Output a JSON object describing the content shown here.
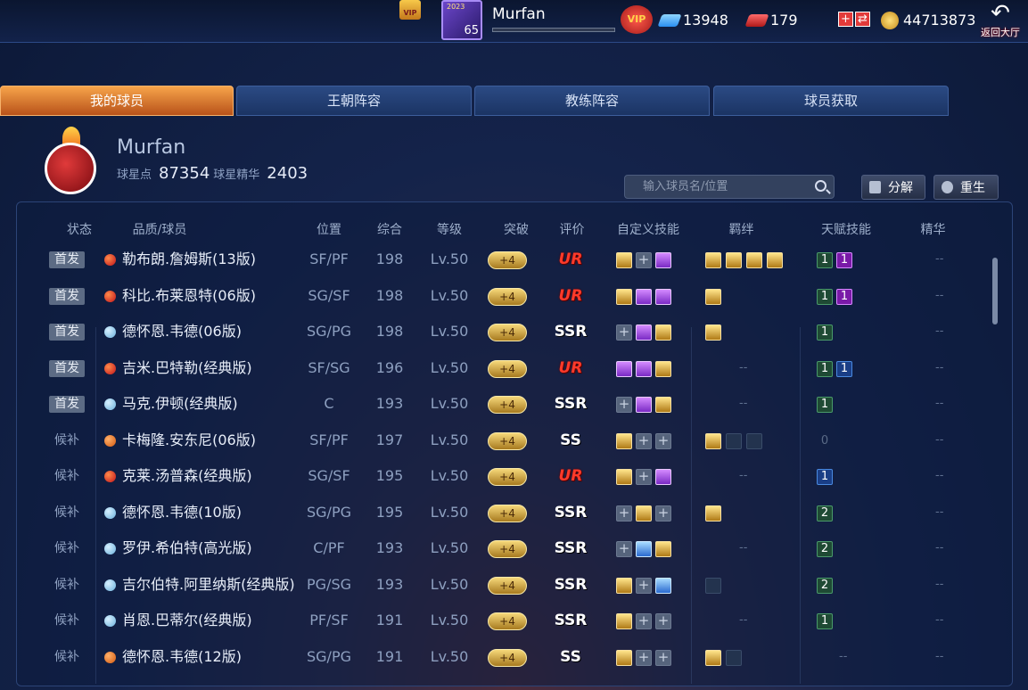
{
  "topbar": {
    "vip_crown": "VIP",
    "avatar_year": "2023",
    "level": "65",
    "username": "Murfan",
    "vip_badge": "VIP",
    "diamonds": "13948",
    "tickets": "179",
    "gold": "44713873",
    "back_label": "返回大厅",
    "icons": [
      "crown-icon",
      "diamond-icon",
      "ticket-icon",
      "coin-icon",
      "back-arrow-icon"
    ]
  },
  "tabs": [
    {
      "label": "我的球员",
      "active": true
    },
    {
      "label": "王朝阵容",
      "active": false
    },
    {
      "label": "教练阵容",
      "active": false
    },
    {
      "label": "球员获取",
      "active": false
    }
  ],
  "team": {
    "name": "Murfan",
    "star_points_label": "球星点",
    "star_points": "87354",
    "essence_label": "球星精华",
    "essence": "2403"
  },
  "toolbar": {
    "search_placeholder": "输入球员名/位置",
    "decompose_label": "分解",
    "rebirth_label": "重生"
  },
  "columns": [
    "状态",
    "品质/球员",
    "位置",
    "综合",
    "等级",
    "突破",
    "评价",
    "自定义技能",
    "羁绊",
    "天赋技能",
    "精华"
  ],
  "colors": {
    "accent_tab": "#e8842a",
    "grade_ur": "#ff3a2a",
    "panel": "#0c1c3e"
  },
  "players": [
    {
      "status": "首发",
      "starter": true,
      "quality": "red",
      "name": "勒布朗.詹姆斯(13版)",
      "position": "SF/PF",
      "overall": "198",
      "level": "Lv.50",
      "break": "+4",
      "grade": "UR",
      "skills": [
        "gold",
        "empty",
        "purple"
      ],
      "bonds": [
        "gold",
        "gold",
        "gold",
        "gold"
      ],
      "bond_text": "",
      "talents": [
        {
          "v": "1",
          "c": "green"
        },
        {
          "v": "1",
          "c": "purple"
        }
      ],
      "essence": "--"
    },
    {
      "status": "首发",
      "starter": true,
      "quality": "red",
      "name": "科比.布莱恩特(06版)",
      "position": "SG/SF",
      "overall": "198",
      "level": "Lv.50",
      "break": "+4",
      "grade": "UR",
      "skills": [
        "gold",
        "purple",
        "purple"
      ],
      "bonds": [
        "gold"
      ],
      "bond_text": "",
      "talents": [
        {
          "v": "1",
          "c": "green"
        },
        {
          "v": "1",
          "c": "purple"
        }
      ],
      "essence": "--"
    },
    {
      "status": "首发",
      "starter": true,
      "quality": "blue",
      "name": "德怀恩.韦德(06版)",
      "position": "SG/PG",
      "overall": "198",
      "level": "Lv.50",
      "break": "+4",
      "grade": "SSR",
      "skills": [
        "empty",
        "purple",
        "gold"
      ],
      "bonds": [
        "gold"
      ],
      "bond_text": "",
      "talents": [
        {
          "v": "1",
          "c": "green"
        }
      ],
      "essence": "--"
    },
    {
      "status": "首发",
      "starter": true,
      "quality": "red",
      "name": "吉米.巴特勒(经典版)",
      "position": "SF/SG",
      "overall": "196",
      "level": "Lv.50",
      "break": "+4",
      "grade": "UR",
      "skills": [
        "purple",
        "purple",
        "gold"
      ],
      "bonds": [],
      "bond_text": "--",
      "talents": [
        {
          "v": "1",
          "c": "green"
        },
        {
          "v": "1",
          "c": "blue"
        }
      ],
      "essence": "--"
    },
    {
      "status": "首发",
      "starter": true,
      "quality": "blue",
      "name": "马克.伊顿(经典版)",
      "position": "C",
      "overall": "193",
      "level": "Lv.50",
      "break": "+4",
      "grade": "SSR",
      "skills": [
        "empty",
        "purple",
        "gold"
      ],
      "bonds": [],
      "bond_text": "--",
      "talents": [
        {
          "v": "1",
          "c": "green"
        }
      ],
      "essence": "--"
    },
    {
      "status": "候补",
      "starter": false,
      "quality": "orange",
      "name": "卡梅隆.安东尼(06版)",
      "position": "SF/PF",
      "overall": "197",
      "level": "Lv.50",
      "break": "+4",
      "grade": "SS",
      "skills": [
        "gold",
        "empty",
        "empty"
      ],
      "bonds": [
        "gold",
        "dim",
        "dim"
      ],
      "bond_text": "",
      "talents": [
        {
          "v": "0",
          "c": "gray"
        }
      ],
      "essence": "--"
    },
    {
      "status": "候补",
      "starter": false,
      "quality": "red",
      "name": "克莱.汤普森(经典版)",
      "position": "SG/SF",
      "overall": "195",
      "level": "Lv.50",
      "break": "+4",
      "grade": "UR",
      "skills": [
        "gold",
        "empty",
        "purple"
      ],
      "bonds": [],
      "bond_text": "--",
      "talents": [
        {
          "v": "1",
          "c": "blue"
        }
      ],
      "essence": "--"
    },
    {
      "status": "候补",
      "starter": false,
      "quality": "blue",
      "name": "德怀恩.韦德(10版)",
      "position": "SG/PG",
      "overall": "195",
      "level": "Lv.50",
      "break": "+4",
      "grade": "SSR",
      "skills": [
        "empty",
        "gold",
        "empty"
      ],
      "bonds": [
        "gold"
      ],
      "bond_text": "",
      "talents": [
        {
          "v": "2",
          "c": "green"
        }
      ],
      "essence": "--"
    },
    {
      "status": "候补",
      "starter": false,
      "quality": "blue",
      "name": "罗伊.希伯特(高光版)",
      "position": "C/PF",
      "overall": "193",
      "level": "Lv.50",
      "break": "+4",
      "grade": "SSR",
      "skills": [
        "empty",
        "blue",
        "gold"
      ],
      "bonds": [],
      "bond_text": "--",
      "talents": [
        {
          "v": "2",
          "c": "green"
        }
      ],
      "essence": "--"
    },
    {
      "status": "候补",
      "starter": false,
      "quality": "blue",
      "name": "吉尔伯特.阿里纳斯(经典版)",
      "position": "PG/SG",
      "overall": "193",
      "level": "Lv.50",
      "break": "+4",
      "grade": "SSR",
      "skills": [
        "gold",
        "empty",
        "blue"
      ],
      "bonds": [
        "dim"
      ],
      "bond_text": "",
      "talents": [
        {
          "v": "2",
          "c": "green"
        }
      ],
      "essence": "--"
    },
    {
      "status": "候补",
      "starter": false,
      "quality": "blue",
      "name": "肖恩.巴蒂尔(经典版)",
      "position": "PF/SF",
      "overall": "191",
      "level": "Lv.50",
      "break": "+4",
      "grade": "SSR",
      "skills": [
        "gold",
        "empty",
        "empty"
      ],
      "bonds": [],
      "bond_text": "--",
      "talents": [
        {
          "v": "1",
          "c": "green"
        }
      ],
      "essence": "--"
    },
    {
      "status": "候补",
      "starter": false,
      "quality": "orange",
      "name": "德怀恩.韦德(12版)",
      "position": "SG/PG",
      "overall": "191",
      "level": "Lv.50",
      "break": "+4",
      "grade": "SS",
      "skills": [
        "gold",
        "empty",
        "empty"
      ],
      "bonds": [
        "gold",
        "dim"
      ],
      "bond_text": "",
      "talents": [],
      "talent_text": "--",
      "essence": "--"
    }
  ]
}
